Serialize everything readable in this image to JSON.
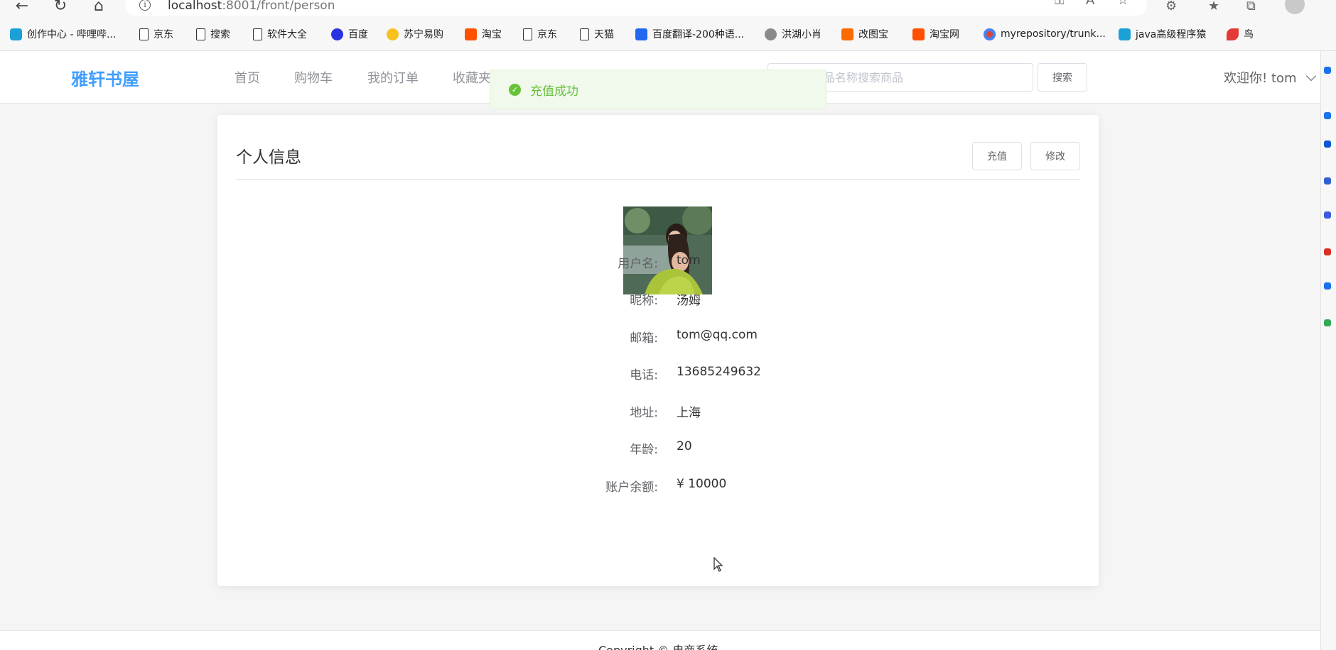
{
  "browser": {
    "url_host": "localhost",
    "url_rest": ":8001/front/person"
  },
  "bookmarks": [
    {
      "label": "创作中心 - 哔哩哔...",
      "icon": "bilibili-icon"
    },
    {
      "label": "京东",
      "icon": "page-icon"
    },
    {
      "label": "搜索",
      "icon": "page-icon"
    },
    {
      "label": "软件大全",
      "icon": "page-icon"
    },
    {
      "label": "百度",
      "icon": "baidu-icon"
    },
    {
      "label": "苏宁易购",
      "icon": "suning-icon"
    },
    {
      "label": "淘宝",
      "icon": "taobao-icon"
    },
    {
      "label": "京东",
      "icon": "page-icon"
    },
    {
      "label": "天猫",
      "icon": "page-icon"
    },
    {
      "label": "百度翻译-200种语...",
      "icon": "fanyi-icon"
    },
    {
      "label": "洪湖小肖",
      "icon": "hong-icon"
    },
    {
      "label": "改图宝",
      "icon": "gaitu-icon"
    },
    {
      "label": "淘宝网",
      "icon": "taobao-icon"
    },
    {
      "label": "myrepository/trunk...",
      "icon": "chrome-icon"
    },
    {
      "label": "java高级程序猿",
      "icon": "bilibili-icon"
    },
    {
      "label": "鸟",
      "icon": "bird-icon"
    }
  ],
  "header": {
    "logo": "雅轩书屋",
    "nav": [
      "首页",
      "购物车",
      "我的订单",
      "收藏夹"
    ],
    "search_placeholder": "请输入商品名称搜索商品",
    "search_button": "搜索",
    "welcome": "欢迎你!",
    "username": "tom"
  },
  "toast": {
    "message": "充值成功",
    "color": "#67c23a"
  },
  "card": {
    "title": "个人信息",
    "recharge_button": "充值",
    "edit_button": "修改"
  },
  "profile": [
    {
      "label": "用户名:",
      "value": "tom"
    },
    {
      "label": "昵称:",
      "value": "汤姆"
    },
    {
      "label": "邮箱:",
      "value": "tom@qq.com"
    },
    {
      "label": "电话:",
      "value": "13685249632"
    },
    {
      "label": "地址:",
      "value": "上海"
    },
    {
      "label": "年龄:",
      "value": "20"
    },
    {
      "label": "账户余额:",
      "value": "¥ 10000"
    }
  ],
  "footer": {
    "text": "Copyright © 电商系统"
  },
  "colors": {
    "accent": "#409eff",
    "success": "#67c23a"
  }
}
